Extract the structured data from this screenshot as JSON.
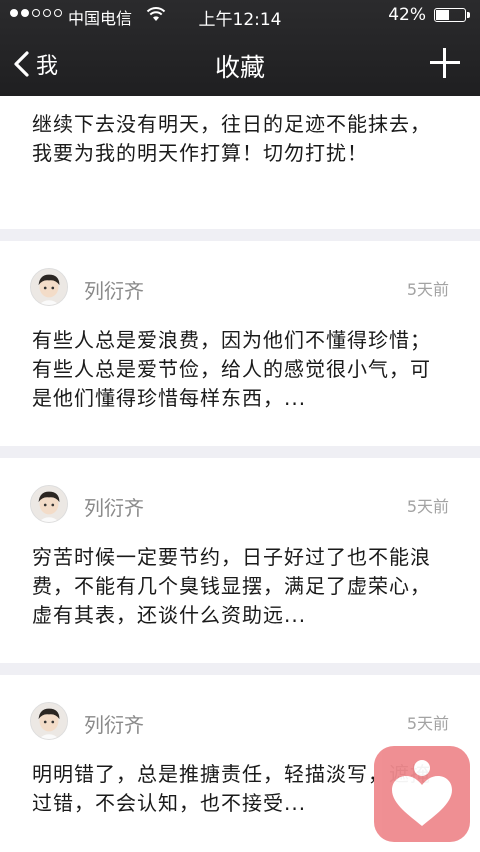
{
  "status_bar": {
    "carrier": "中国电信",
    "time": "上午12:14",
    "battery_text": "42%",
    "battery_level": 0.42
  },
  "nav": {
    "back_label": "我",
    "title": "收藏"
  },
  "first_item": {
    "text": "继续下去没有明天，往日的足迹不能抹去，我要为我的明天作打算！切勿打扰！"
  },
  "items": [
    {
      "author": "列衍齐",
      "time": "5天前",
      "text": "有些人总是爱浪费，因为他们不懂得珍惜；有些人总是爱节俭，给人的感觉很小气，可是他们懂得珍惜每样东西，..."
    },
    {
      "author": "列衍齐",
      "time": "5天前",
      "text": "穷苦时候一定要节约，日子好过了也不能浪费，不能有几个臭钱显摆，满足了虚荣心，虚有其表，还谈什么资助远..."
    },
    {
      "author": "列衍齐",
      "time": "5天前",
      "text": "明明错了，总是推搪责任，轻描淡写，遮掩过错，不会认知，也不接受..."
    }
  ],
  "icons": {
    "back": "chevron-left-icon",
    "add": "plus-icon",
    "floating_app": "heart-icon"
  },
  "colors": {
    "nav_bg": "#222224",
    "page_bg": "#efeff4",
    "floating_icon_bg": "#ef8a8e"
  }
}
